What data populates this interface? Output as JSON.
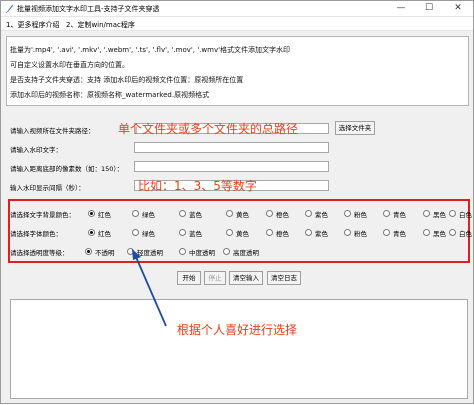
{
  "window": {
    "title": "批量视频添加文字水印工具-支持子文件夹穿透",
    "controls": [
      "—",
      "☐",
      "✕"
    ]
  },
  "menu": [
    "1、更多程序介绍",
    "2、定制win/mac程序"
  ],
  "info_lines": [
    "批量为'.mp4', '.avi', '.mkv', '.webm', '.ts', '.flv', '.mov', '.wmv'格式文件添加文字水印",
    "可自定义设置水印在垂直方向的位置。",
    "是否支持子文件夹穿透：支持          添加水印后的视频文件位置：原视频所在位置",
    "添加水印后的视频名称：原视频名称_watermarked.原视频格式"
  ],
  "form": {
    "folder_label": "请输入视频所在文件夹路径：",
    "folder_value": "",
    "select_folder_button": "选择文件夹",
    "text_label": "请输入水印文字：",
    "text_value": "",
    "distance_label": "请输入距离底部的像素数（如：150）：",
    "distance_value": "",
    "duration_label": "输入水印显示间隔（秒）：",
    "duration_value": ""
  },
  "annotations": {
    "path_hint": "单个文件夹或多个文件夹的总路径",
    "number_hint": "比如：1、3、5等数字",
    "choice_hint": "根据个人喜好进行选择"
  },
  "options": {
    "bg_color": {
      "label": "请选择文字背景颜色：",
      "choices": [
        "红色",
        "绿色",
        "蓝色",
        "黄色",
        "橙色",
        "紫色",
        "粉色",
        "青色",
        "黑色",
        "白色"
      ],
      "selected": 0
    },
    "font_color": {
      "label": "请选择字体颜色：",
      "choices": [
        "红色",
        "绿色",
        "蓝色",
        "黄色",
        "橙色",
        "紫色",
        "粉色",
        "青色",
        "黑色",
        "白色"
      ],
      "selected": 0
    },
    "transparency": {
      "label": "请选择透明度等级：",
      "choices": [
        "不透明",
        "轻度透明",
        "中度透明",
        "高度透明"
      ],
      "selected": 0
    }
  },
  "buttons": {
    "start": "开始",
    "stop": "停止",
    "clear_input": "清空输入",
    "clear_log": "清空日志"
  },
  "log_text": "",
  "colors": {
    "accent_annotation": "#e8401c",
    "highlight_box": "#e02020",
    "arrow": "#1f4ba5"
  }
}
